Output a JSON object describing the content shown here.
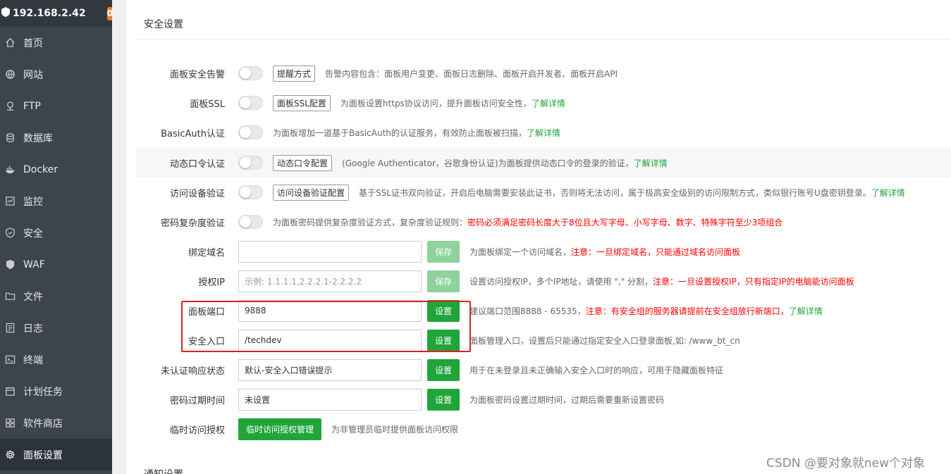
{
  "sidebar": {
    "server_ip": "192.168.2.42",
    "badge_count": "0",
    "items": [
      {
        "label": "首页",
        "icon": "home-icon"
      },
      {
        "label": "网站",
        "icon": "globe-icon"
      },
      {
        "label": "FTP",
        "icon": "ftp-icon"
      },
      {
        "label": "数据库",
        "icon": "database-icon"
      },
      {
        "label": "Docker",
        "icon": "docker-icon"
      },
      {
        "label": "监控",
        "icon": "monitor-icon"
      },
      {
        "label": "安全",
        "icon": "shield-icon"
      },
      {
        "label": "WAF",
        "icon": "waf-shield-icon"
      },
      {
        "label": "文件",
        "icon": "folder-icon"
      },
      {
        "label": "日志",
        "icon": "log-icon"
      },
      {
        "label": "终端",
        "icon": "terminal-icon"
      },
      {
        "label": "计划任务",
        "icon": "calendar-icon"
      },
      {
        "label": "软件商店",
        "icon": "grid-icon"
      },
      {
        "label": "面板设置",
        "icon": "gear-icon",
        "active": true
      }
    ]
  },
  "section_title": "安全设置",
  "next_section_title": "通知设置",
  "settings": {
    "panel_alert": {
      "label": "面板安全告警",
      "button": "提醒方式",
      "desc": "告警内容包含：面板用户变更、面板日志删除、面板开启开发者、面板开启API"
    },
    "panel_ssl": {
      "label": "面板SSL",
      "button": "面板SSL配置",
      "desc": "为面板设置https协议访问，提升面板访问安全性，",
      "link": "了解详情"
    },
    "basic_auth": {
      "label": "BasicAuth认证",
      "desc": "为面板增加一道基于BasicAuth的认证服务，有效防止面板被扫描，",
      "link": "了解详情"
    },
    "dynamic_code": {
      "label": "动态口令认证",
      "button": "动态口令配置",
      "desc": "(Google Authenticator，谷歌身份认证)为面板提供动态口令的登录的验证，",
      "link": "了解详情"
    },
    "device_verify": {
      "label": "访问设备验证",
      "button": "访问设备验证配置",
      "desc": "基于SSL证书双向验证，开启后电脑需要安装此证书，否则将无法访问，属于极高安全级别的访问限制方式，类似银行账号U盘密钥登录。",
      "link": "了解详情"
    },
    "password_complexity": {
      "label": "密码复杂度验证",
      "desc": "为面板密码提供复杂度验证方式，复杂度验证规则：",
      "warn": "密码必须满足密码长度大于8位且大写字母、小写字母、数字、特殊字符至少3项组合"
    },
    "bind_domain": {
      "label": "绑定域名",
      "value": "",
      "button": "保存",
      "desc": "为面板绑定一个访问域名，",
      "warn": "注意：一旦绑定域名，只能通过域名访问面板"
    },
    "auth_ip": {
      "label": "授权IP",
      "placeholder": "示例: 1.1.1.1,2.2.2.1-2.2.2.2",
      "button": "保存",
      "desc": "设置访问授权IP，多个IP地址，请使用 \",\" 分割，",
      "warn": "注意：一旦设置授权IP，只有指定IP的电脑能访问面板"
    },
    "panel_port": {
      "label": "面板端口",
      "value": "9888",
      "button": "设置",
      "desc": "建议端口范围8888 - 65535，",
      "warn": "注意：有安全组的服务器请提前在安全组放行新端口，",
      "link": "了解详情"
    },
    "safe_entry": {
      "label": "安全入口",
      "value": "/techdev",
      "button": "设置",
      "desc": "面板管理入口，设置后只能通过指定安全入口登录面板,如: /www_bt_cn"
    },
    "unauth_response": {
      "label": "未认证响应状态",
      "value": "默认-安全入口错误提示",
      "button": "设置",
      "desc": "用于在未登录且未正确输入安全入口时的响应，可用于隐藏面板特征"
    },
    "password_expire": {
      "label": "密码过期时间",
      "value": "未设置",
      "button": "设置",
      "desc": "为面板密码设置过期时间，过期后需要重新设置密码"
    },
    "temp_access": {
      "label": "临时访问授权",
      "button": "临时访问授权管理",
      "desc": "为非管理员临时提供面板访问权限"
    }
  },
  "watermark": "CSDN @要对象就new个对象",
  "colors": {
    "primary_green": "#20a53a",
    "warning_red": "#ff0000",
    "sidebar_bg": "#3c444d",
    "badge_orange": "#f0812b",
    "highlight_box": "#e02020"
  }
}
